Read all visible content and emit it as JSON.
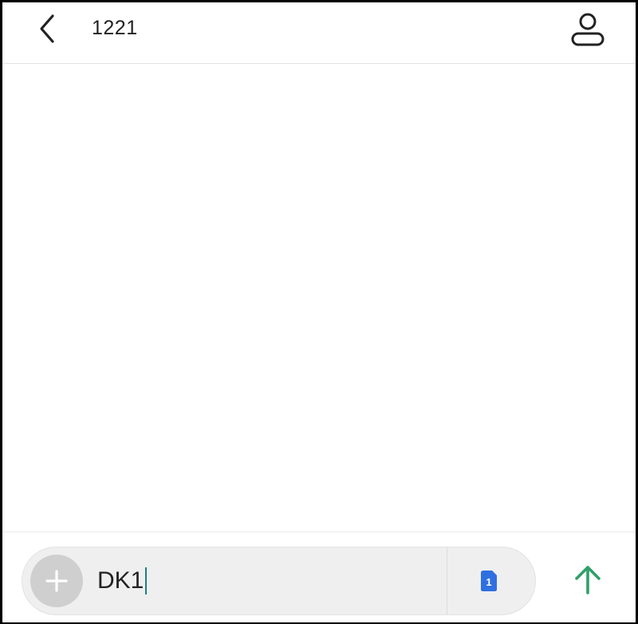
{
  "header": {
    "title": "1221",
    "back_icon": "chevron-left-icon",
    "contact_icon": "person-icon"
  },
  "composer": {
    "input_value": "DK1",
    "plus_icon": "plus-icon",
    "sim_badge_label": "1",
    "sim_icon": "sim-card-icon",
    "send_icon": "arrow-up-icon"
  },
  "colors": {
    "sim_badge": "#2f6fe0",
    "send_arrow": "#2fa06a",
    "plus_circle": "#cfcfcf",
    "caret": "#1a7f86"
  }
}
